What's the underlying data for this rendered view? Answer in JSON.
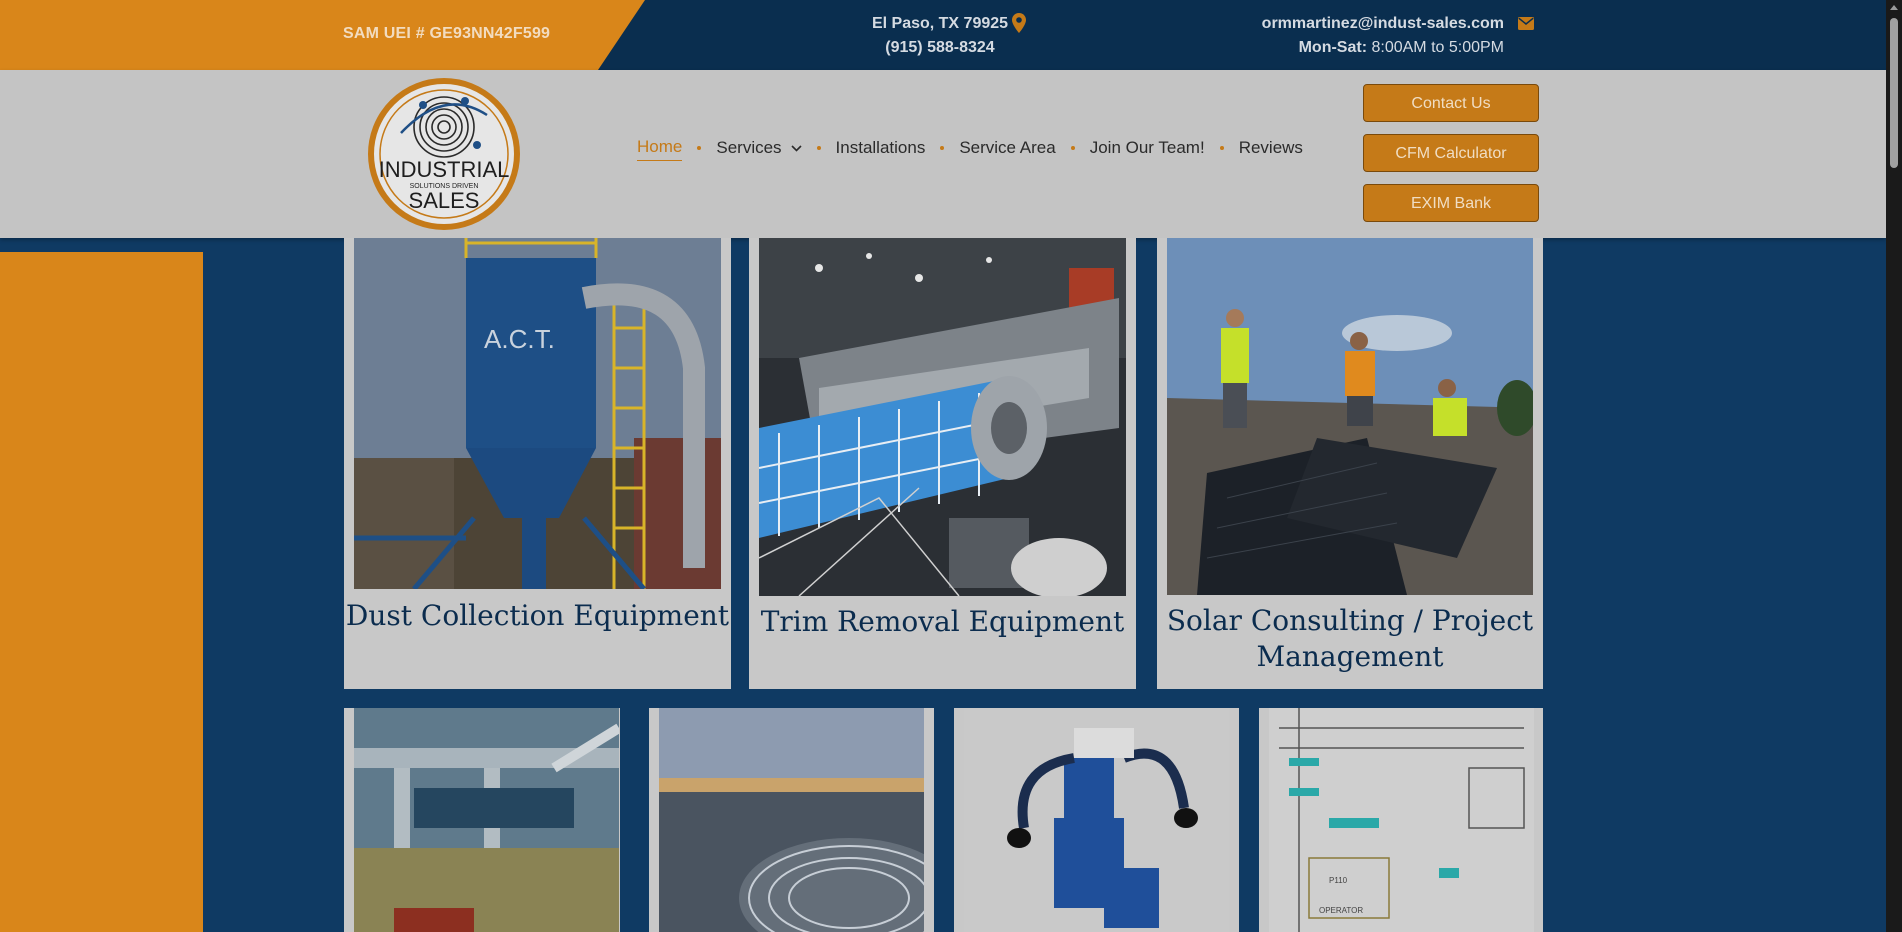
{
  "topbar": {
    "sam_uei": "SAM UEI # GE93NN42F599",
    "city": "El Paso, TX 79925",
    "phone": "(915) 588-8324",
    "email": "ormmartinez@indust-sales.com",
    "hours_label": "Mon-Sat:",
    "hours_value": "8:00AM to 5:00PM",
    "location_icon": "map-pin-icon",
    "email_icon": "envelope-icon"
  },
  "logo": {
    "line1": "INDUSTRIAL",
    "line2": "SOLUTIONS DRIVEN",
    "line3": "SALES"
  },
  "nav": {
    "items": [
      {
        "label": "Home",
        "active": true
      },
      {
        "label": "Services",
        "has_dropdown": true
      },
      {
        "label": "Installations"
      },
      {
        "label": "Service Area"
      },
      {
        "label": "Join Our Team!"
      },
      {
        "label": "Reviews"
      }
    ]
  },
  "buttons": {
    "contact": "Contact Us",
    "cfm": "CFM Calculator",
    "exim": "EXIM Bank"
  },
  "cards": [
    {
      "title": "Dust Collection Equipment"
    },
    {
      "title": "Trim Removal Equipment"
    },
    {
      "title": "Solar Consulting / Project Management"
    }
  ],
  "colors": {
    "brand_orange": "#d9861a",
    "brand_navy": "#0a2e4f",
    "title_navy": "#0b2c4e"
  }
}
